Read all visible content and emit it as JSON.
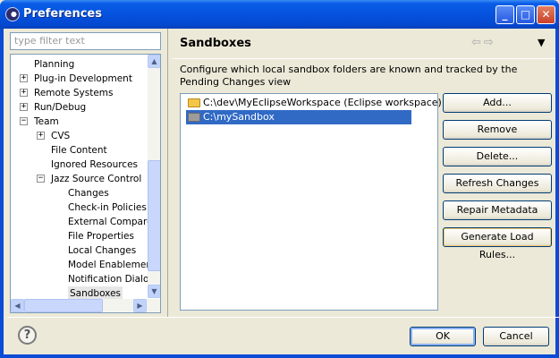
{
  "window": {
    "title": "Preferences",
    "app_icon": "eclipse-icon",
    "caption_buttons": {
      "minimize": "_",
      "maximize": "□",
      "close": "✕"
    }
  },
  "sidebar": {
    "filter_placeholder": "type filter text",
    "tree": [
      {
        "label": "Planning",
        "expander": "",
        "selected": false
      },
      {
        "label": "Plug-in Development",
        "expander": "+",
        "selected": false
      },
      {
        "label": "Remote Systems",
        "expander": "+",
        "selected": false
      },
      {
        "label": "Run/Debug",
        "expander": "+",
        "selected": false
      },
      {
        "label": "Team",
        "expander": "−",
        "selected": false
      },
      {
        "label": "CVS",
        "expander": "+",
        "selected": false
      },
      {
        "label": "File Content",
        "expander": "",
        "selected": false
      },
      {
        "label": "Ignored Resources",
        "expander": "",
        "selected": false
      },
      {
        "label": "Jazz Source Control",
        "expander": "−",
        "selected": false
      },
      {
        "label": "Changes",
        "expander": "",
        "selected": false
      },
      {
        "label": "Check-in Policies",
        "expander": "",
        "selected": false
      },
      {
        "label": "External Compare",
        "expander": "",
        "selected": false
      },
      {
        "label": "File Properties",
        "expander": "",
        "selected": false
      },
      {
        "label": "Local Changes",
        "expander": "",
        "selected": false
      },
      {
        "label": "Model Enablement",
        "expander": "",
        "selected": false
      },
      {
        "label": "Notification Dialog",
        "expander": "",
        "selected": false
      },
      {
        "label": "Sandboxes",
        "expander": "",
        "selected": true
      }
    ],
    "scroll_glyphs": {
      "up": "▲",
      "down": "▼",
      "left": "◀",
      "right": "▶"
    }
  },
  "main": {
    "title": "Sandboxes",
    "nav": {
      "back": "⇦",
      "forward": "⇨",
      "menu": "▼"
    },
    "description": "Configure which local sandbox folders are known and tracked by the Pending Changes view",
    "sandboxes": [
      {
        "path": "C:\\dev\\MyEclipseWorkspace (Eclipse workspace)",
        "icon": "open-folder-icon",
        "selected": false
      },
      {
        "path": "C:\\mySandbox",
        "icon": "folder-icon",
        "selected": true
      }
    ],
    "buttons": {
      "add": "Add...",
      "remove": "Remove",
      "delete": "Delete...",
      "refresh": "Refresh Changes",
      "repair": "Repair Metadata",
      "generate": "Generate Load Rules..."
    }
  },
  "footer": {
    "help": "?",
    "ok": "OK",
    "cancel": "Cancel"
  }
}
